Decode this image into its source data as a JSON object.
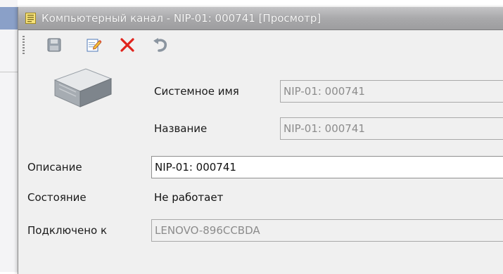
{
  "window": {
    "title": "Компьютерный канал - NIP-01: 000741 [Просмотр]",
    "title_icon": "document-icon",
    "titlebar_color": "#a9a9ab"
  },
  "toolbar": {
    "buttons": [
      {
        "name": "save",
        "icon": "floppy-disk-icon",
        "enabled": false
      },
      {
        "name": "edit",
        "icon": "edit-pencil-icon",
        "enabled": true
      },
      {
        "name": "delete",
        "icon": "red-x-icon",
        "enabled": true,
        "color": "#e0231c"
      },
      {
        "name": "undo",
        "icon": "undo-arrow-icon",
        "enabled": false
      }
    ]
  },
  "device": {
    "icon": "computer-case-icon"
  },
  "fields": {
    "system_name": {
      "label": "Системное имя",
      "value": "NIP-01: 000741"
    },
    "name": {
      "label": "Название",
      "value": "NIP-01: 000741"
    },
    "description": {
      "label": "Описание",
      "value": "NIP-01: 000741"
    },
    "state": {
      "label": "Состояние",
      "value": "Не работает"
    },
    "connected_to": {
      "label": "Подключено к",
      "value": "LENOVO-896CCBDA"
    }
  }
}
